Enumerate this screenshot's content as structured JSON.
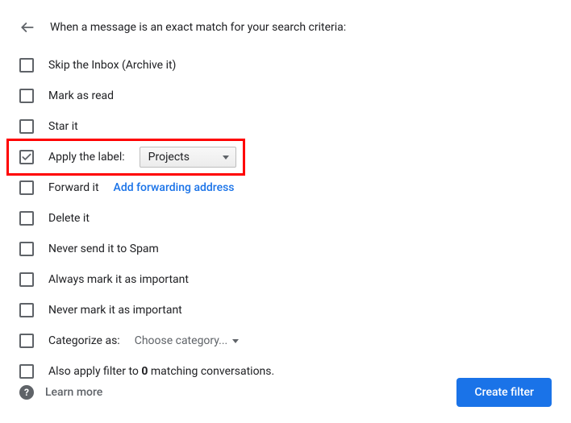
{
  "header": {
    "title": "When a message is an exact match for your search criteria:"
  },
  "options": {
    "skip_inbox": "Skip the Inbox (Archive it)",
    "mark_read": "Mark as read",
    "star_it": "Star it",
    "apply_label": "Apply the label:",
    "apply_label_value": "Projects",
    "forward_it": "Forward it",
    "forward_link": "Add forwarding address",
    "delete_it": "Delete it",
    "never_spam": "Never send it to Spam",
    "always_important": "Always mark it as important",
    "never_important": "Never mark it as important",
    "categorize_as": "Categorize as:",
    "categorize_value": "Choose category...",
    "also_apply_prefix": "Also apply filter to ",
    "also_apply_count": "0",
    "also_apply_suffix": " matching conversations."
  },
  "footer": {
    "learn_more": "Learn more",
    "create_filter": "Create filter"
  }
}
